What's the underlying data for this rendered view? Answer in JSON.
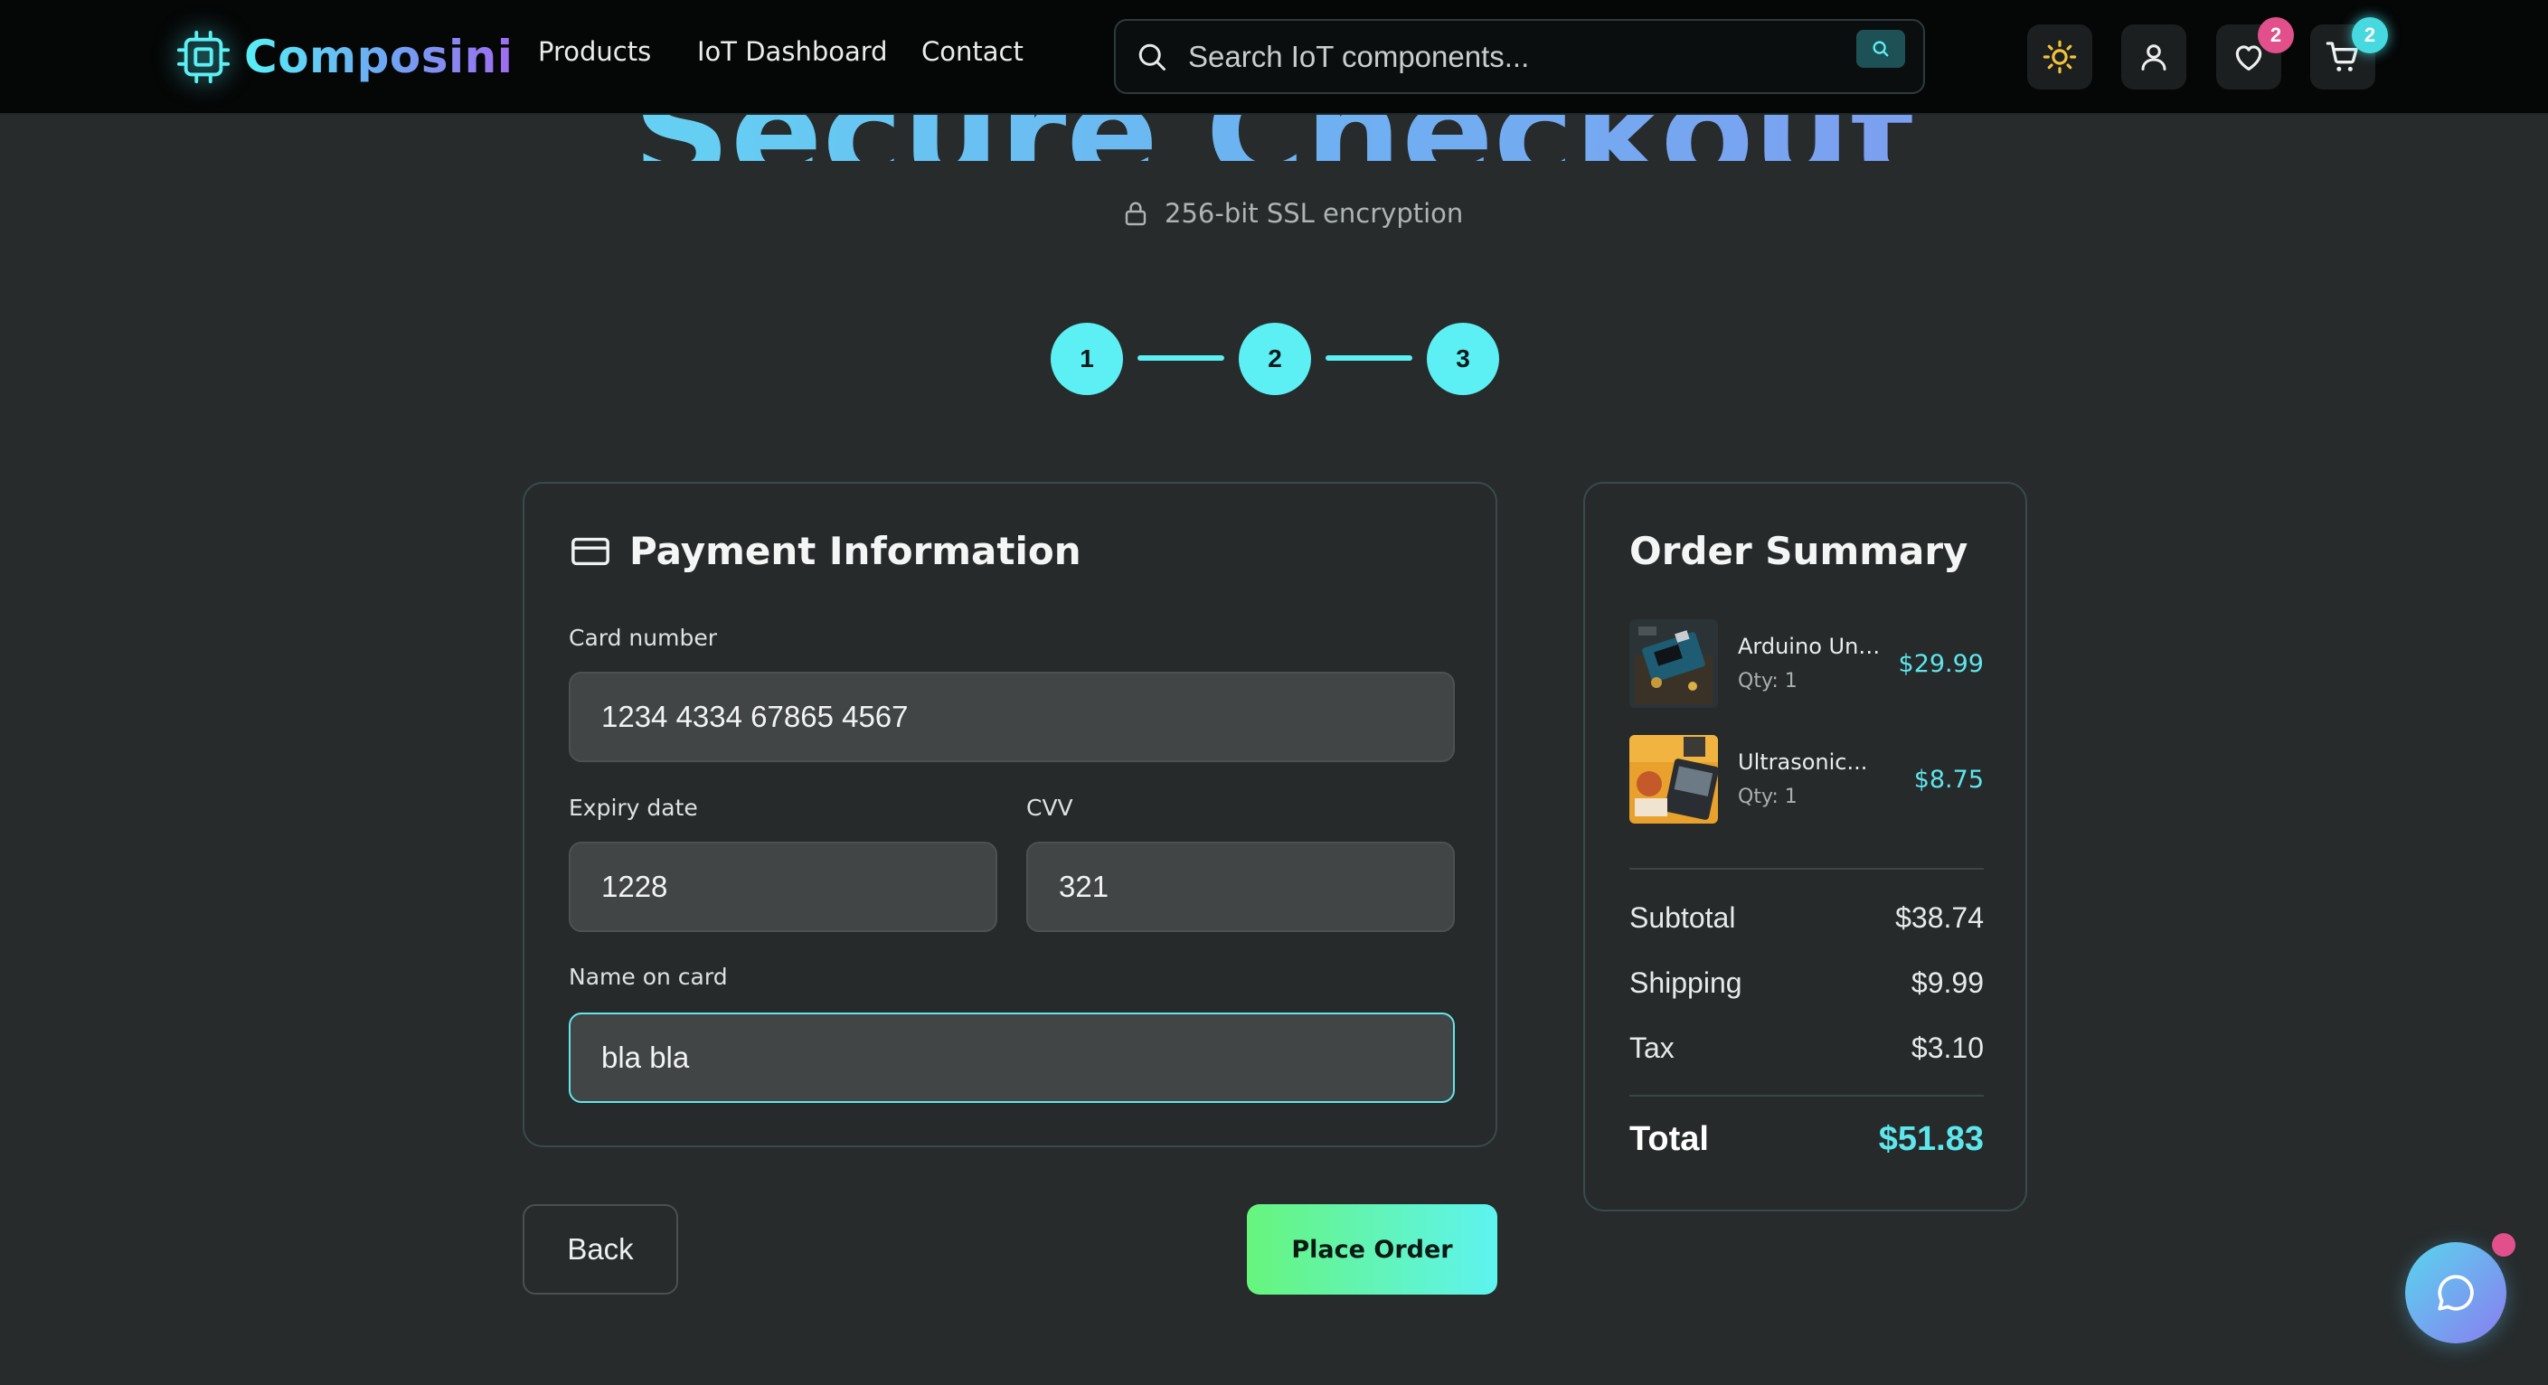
{
  "header": {
    "brand": "Composini",
    "nav": {
      "products": "Products",
      "iot_dashboard": "IoT Dashboard",
      "contact": "Contact"
    },
    "search": {
      "placeholder": "Search IoT components..."
    },
    "wishlist_count": "2",
    "cart_count": "2"
  },
  "page": {
    "title": "Secure Checkout",
    "ssl_text": "256-bit SSL encryption",
    "steps": [
      "1",
      "2",
      "3"
    ]
  },
  "payment": {
    "heading": "Payment Information",
    "card_number_label": "Card number",
    "card_number_value": "1234 4334 67865 4567",
    "expiry_label": "Expiry date",
    "expiry_value": "1228",
    "cvv_label": "CVV",
    "cvv_value": "321",
    "name_label": "Name on card",
    "name_value": "bla bla"
  },
  "actions": {
    "back": "Back",
    "place_order": "Place Order"
  },
  "summary": {
    "title": "Order Summary",
    "items": [
      {
        "name": "Arduino Uno...",
        "qty": "Qty: 1",
        "price": "$29.99"
      },
      {
        "name": "Ultrasonic...",
        "qty": "Qty: 1",
        "price": "$8.75"
      }
    ],
    "subtotal_label": "Subtotal",
    "subtotal_value": "$38.74",
    "shipping_label": "Shipping",
    "shipping_value": "$9.99",
    "tax_label": "Tax",
    "tax_value": "$3.10",
    "total_label": "Total",
    "total_value": "$51.83"
  },
  "icons": {
    "brand": "chip-icon",
    "search": "search-icon",
    "theme": "sun-icon",
    "user": "user-icon",
    "wishlist": "heart-icon",
    "cart": "cart-icon",
    "ssl": "lock-icon",
    "payment": "credit-card-icon",
    "chat": "chat-bubble-icon"
  },
  "colors": {
    "accent": "#5cf0f5",
    "badge_pink": "#e2508c",
    "place_order_start": "#66f57c",
    "place_order_end": "#5ef3f0",
    "background": "#272b2c"
  }
}
